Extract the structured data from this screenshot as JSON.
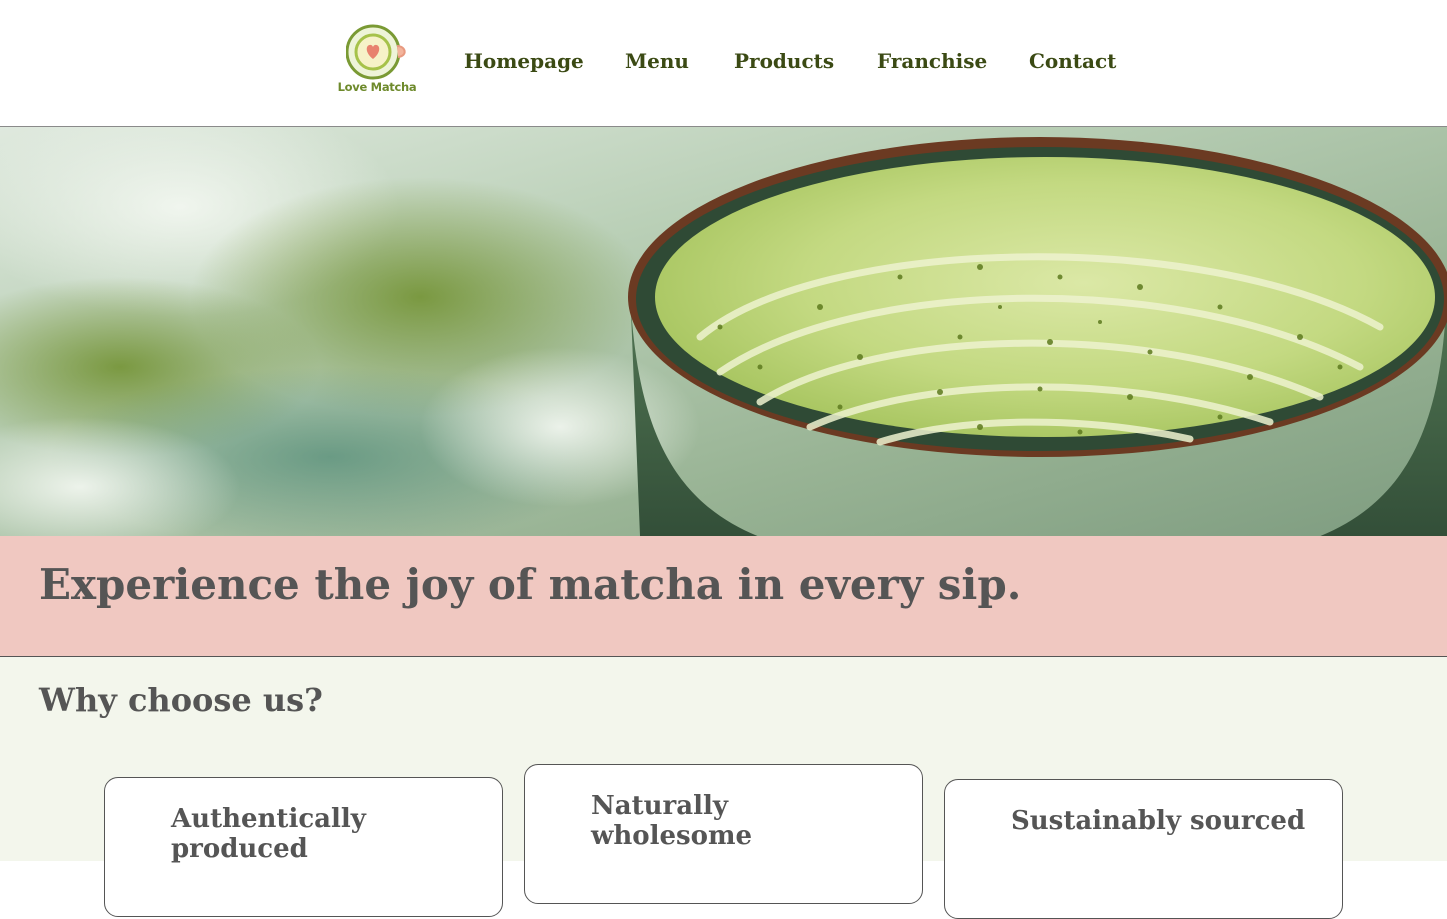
{
  "brand": {
    "name": "Love Matcha",
    "colors": {
      "primary": "#3b4a14",
      "logo_green": "#6e8a2c",
      "logo_ring": "#8aa83a",
      "heart": "#e8826e"
    }
  },
  "nav": {
    "items": [
      {
        "label": "Homepage"
      },
      {
        "label": "Menu"
      },
      {
        "label": "Products"
      },
      {
        "label": "Franchise"
      },
      {
        "label": "Contact"
      }
    ]
  },
  "hero": {
    "image": "matcha-latte-bowl-photo"
  },
  "banner": {
    "headline": "Experience the joy of matcha in every sip.",
    "background": "#f0c8c1"
  },
  "why": {
    "title": "Why choose us?",
    "cards": [
      {
        "title": "Authentically produced"
      },
      {
        "title": "Naturally wholesome"
      },
      {
        "title": "Sustainably sourced"
      }
    ]
  }
}
